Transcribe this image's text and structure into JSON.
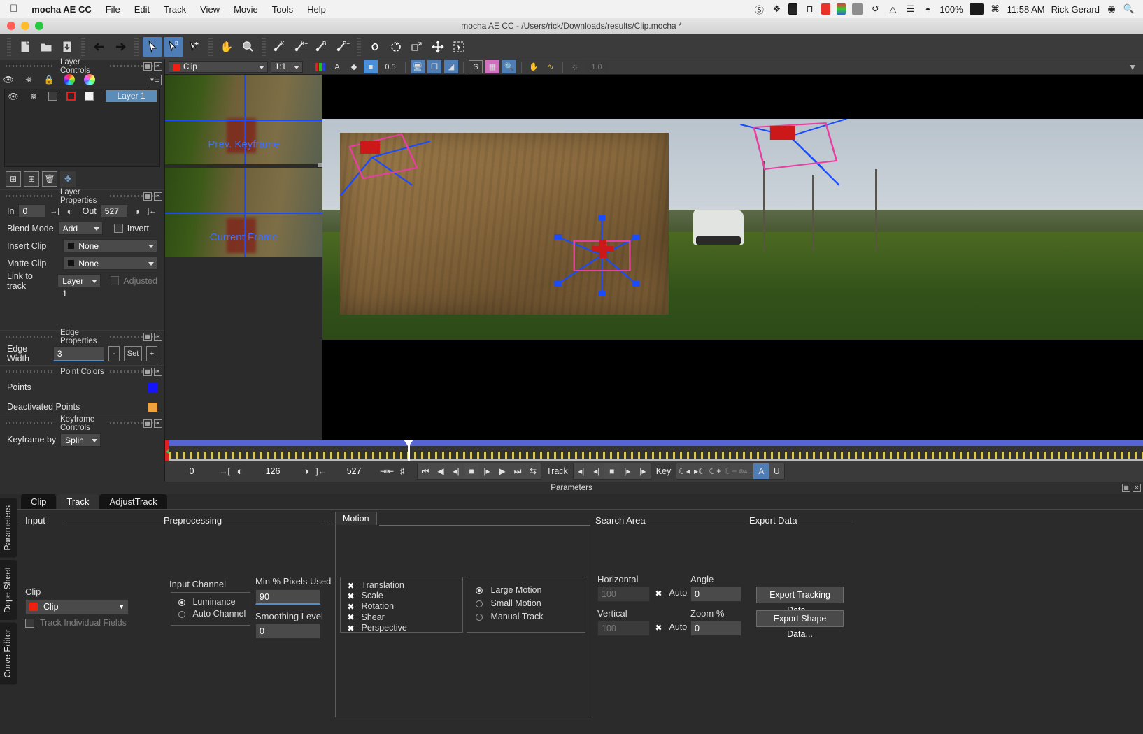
{
  "menubar": {
    "apple": "apple-logo",
    "app": "mocha AE CC",
    "items": [
      "File",
      "Edit",
      "Track",
      "View",
      "Movie",
      "Tools",
      "Help"
    ],
    "status": {
      "battery_percent": "100%",
      "time": "11:58 AM",
      "user": "Rick Gerard",
      "icons": [
        "do-not-disturb-icon",
        "dropbox-icon",
        "battery-monitor-icon",
        "app-icon",
        "equalizer-icon",
        "color-meter-icon",
        "display-icon",
        "time-machine-icon",
        "airplay-icon",
        "bluetooth-icon",
        "wifi-icon",
        "keyboard-icon",
        "spotlight-icon"
      ]
    }
  },
  "window": {
    "title": "mocha AE CC - /Users/rick/Downloads/results/Clip.mocha *",
    "traffic": {
      "close": "#ff5f57",
      "minimize": "#ffbd2e",
      "zoom": "#28c940"
    }
  },
  "toolbar": {
    "groups": [
      {
        "name": "file",
        "buttons": [
          "new-project-icon",
          "open-project-icon",
          "save-project-icon"
        ]
      },
      {
        "name": "history",
        "buttons": [
          "undo-arrow-icon",
          "redo-arrow-icon"
        ]
      },
      {
        "name": "select",
        "buttons": [
          "select-tool-icon",
          "select-b-tool-icon",
          "add-point-tool-icon"
        ]
      },
      {
        "name": "view",
        "buttons": [
          "pan-hand-icon",
          "zoom-magnifier-icon"
        ]
      },
      {
        "name": "spline",
        "buttons": [
          "xspline-tool-icon",
          "xspline-add-tool-icon",
          "bezier-tool-icon",
          "bezier-add-tool-icon"
        ]
      },
      {
        "name": "transform",
        "buttons": [
          "link-icon",
          "rotate-icon",
          "scale-icon",
          "move-icon",
          "select-region-icon"
        ]
      }
    ]
  },
  "layer_controls": {
    "title": "Layer Controls",
    "header_icons": [
      "eye-icon",
      "gear-icon",
      "lock-icon",
      "color-wheel-icon",
      "color-wheel-alt-icon",
      "menu-icon"
    ],
    "layers": [
      {
        "name": "Layer 1",
        "visible": true,
        "gear": true,
        "locked": false,
        "outline_color": "#e02020",
        "fill_color": "#f2f2f2"
      }
    ],
    "buttons": [
      "new-group-icon",
      "new-layer-icon",
      "delete-layer-icon",
      "fit-layer-icon"
    ]
  },
  "layer_properties": {
    "title": "Layer Properties",
    "in_label": "In",
    "in_value": "0",
    "out_label": "Out",
    "out_value": "527",
    "blend_mode_label": "Blend Mode",
    "blend_mode_value": "Add",
    "invert_label": "Invert",
    "invert_checked": false,
    "insert_clip_label": "Insert Clip",
    "insert_clip_value": "None",
    "matte_clip_label": "Matte Clip",
    "matte_clip_value": "None",
    "link_to_track_label": "Link to track",
    "link_to_track_value": "Layer 1",
    "adjusted_label": "Adjusted",
    "adjusted_checked": false
  },
  "edge_properties": {
    "title": "Edge Properties",
    "edge_width_label": "Edge Width",
    "edge_width_value": "3",
    "minus_label": "-",
    "set_label": "Set",
    "plus_label": "+"
  },
  "point_colors": {
    "title": "Point Colors",
    "rows": [
      {
        "label": "Points",
        "color": "#1414ff"
      },
      {
        "label": "Deactivated Points",
        "color": "#f0a33c"
      }
    ]
  },
  "keyframe_controls": {
    "title": "Keyframe Controls",
    "keyframe_by_label": "Keyframe by",
    "keyframe_by_value": "Splin"
  },
  "viewer_toolbar": {
    "clip_value": "Clip",
    "zoom_value": "1:1",
    "channel_icon": "rgb-channels-icon",
    "alpha_label": "A",
    "overlay_icon": "overlay-icon",
    "matte_icon": "matte-icon",
    "matte_opacity": "0.5",
    "monitor_icon": "monitor-icon",
    "layers_icon": "layers-icon",
    "spline_icon": "spline-visibility-icon",
    "surface_icon": "surface-icon",
    "grid_icon": "grid-icon",
    "zoom_window_icon": "zoom-window-icon",
    "stabilize_icon": "stabilize-hand-icon",
    "track_path_icon": "track-path-icon",
    "light_icon": "light-icon",
    "light_value": "1.0"
  },
  "viewer": {
    "thumbnails": [
      {
        "caption": "Prev. Keyframe"
      },
      {
        "caption": "Current Frame"
      }
    ]
  },
  "timeline": {
    "in_frame": "0",
    "current_frame": "126",
    "out_frame": "527",
    "playhead_percent": 24.5,
    "track_label": "Track",
    "key_label": "Key",
    "transport_icons": [
      "go-to-start-icon",
      "play-backward-icon",
      "step-backward-icon",
      "stop-icon",
      "step-forward-icon",
      "play-forward-icon",
      "go-to-end-icon",
      "loop-icon"
    ],
    "track_icons": [
      "track-backward-icon",
      "track-back-frame-icon",
      "track-stop-icon",
      "track-forward-frame-icon",
      "track-forward-icon"
    ],
    "key_icons": [
      "prev-keyframe-icon",
      "next-keyframe-icon",
      "add-keyframe-icon",
      "delete-keyframe-icon",
      "delete-all-keyframes-icon"
    ],
    "key_toggle_a": "A",
    "key_toggle_u": "U",
    "fit_icons": [
      "fit-timeline-icon",
      "fit-range-icon"
    ]
  },
  "parameters_panel": {
    "title": "Parameters",
    "vertical_tabs": [
      "Parameters",
      "Dope Sheet",
      "Curve Editor"
    ],
    "tabs": [
      {
        "label": "Clip",
        "active": false
      },
      {
        "label": "Track",
        "active": true
      },
      {
        "label": "AdjustTrack",
        "active": false
      }
    ],
    "input": {
      "group_label": "Input",
      "clip_label": "Clip",
      "clip_value": "Clip",
      "track_individual_fields_label": "Track Individual Fields",
      "track_individual_fields_checked": false
    },
    "preprocessing": {
      "group_label": "Preprocessing",
      "input_channel_label": "Input Channel",
      "channels": [
        {
          "label": "Luminance",
          "selected": true
        },
        {
          "label": "Auto Channel",
          "selected": false
        }
      ],
      "min_pixels_label": "Min % Pixels Used",
      "min_pixels_value": "90",
      "smoothing_label": "Smoothing Level",
      "smoothing_value": "0"
    },
    "motion": {
      "tab_label": "Motion",
      "checks": [
        {
          "label": "Translation",
          "checked": true
        },
        {
          "label": "Scale",
          "checked": true
        },
        {
          "label": "Rotation",
          "checked": true
        },
        {
          "label": "Shear",
          "checked": true
        },
        {
          "label": "Perspective",
          "checked": true
        }
      ],
      "modes": [
        {
          "label": "Large Motion",
          "selected": true
        },
        {
          "label": "Small Motion",
          "selected": false
        },
        {
          "label": "Manual Track",
          "selected": false
        }
      ]
    },
    "search_area": {
      "group_label": "Search Area",
      "horizontal_label": "Horizontal",
      "horizontal_value": "100",
      "horizontal_auto_label": "Auto",
      "horizontal_auto_checked": true,
      "vertical_label": "Vertical",
      "vertical_value": "100",
      "vertical_auto_label": "Auto",
      "vertical_auto_checked": true,
      "angle_label": "Angle",
      "angle_value": "0",
      "zoom_label": "Zoom %",
      "zoom_value": "0"
    },
    "export_data": {
      "group_label": "Export Data",
      "export_tracking_label": "Export Tracking Data...",
      "export_shape_label": "Export Shape Data..."
    }
  }
}
